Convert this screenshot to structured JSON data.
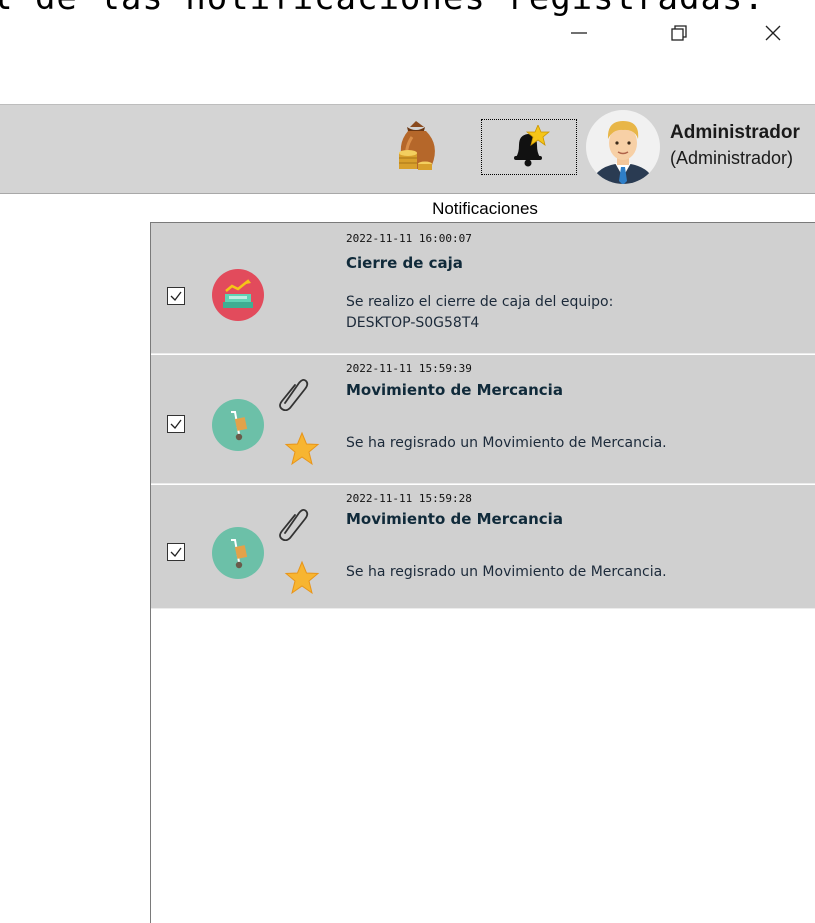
{
  "header_text": "l de las notificaciones registradas.",
  "window_controls": {
    "minimize": "minimize-icon",
    "maximize": "restore-icon",
    "close": "close-icon"
  },
  "toolbar": {
    "money_icon": "money-bag-icon",
    "bell_icon": "bell-star-icon",
    "avatar_icon": "user-avatar-icon",
    "user_name": "Administrador",
    "user_role": "(Administrador)"
  },
  "panel": {
    "title": "Notificaciones",
    "notifications": [
      {
        "checked": true,
        "icon": "cash-register-icon",
        "icon_color": "#e24b5c",
        "timestamp": "2022-11-11 16:00:07",
        "title": "Cierre de caja",
        "body_line1": "Se realizo el cierre de caja del equipo:",
        "body_line2": "DESKTOP-S0G58T4",
        "attachment": false,
        "starred": false
      },
      {
        "checked": true,
        "icon": "hand-truck-icon",
        "icon_color": "#6cc0a8",
        "timestamp": "2022-11-11 15:59:39",
        "title": "Movimiento de Mercancia",
        "body_line1": "Se ha regisrado un Movimiento de Mercancia.",
        "attachment": true,
        "starred": true
      },
      {
        "checked": true,
        "icon": "hand-truck-icon",
        "icon_color": "#6cc0a8",
        "timestamp": "2022-11-11 15:59:28",
        "title": "Movimiento de Mercancia",
        "body_line1": "Se ha regisrado un Movimiento de Mercancia.",
        "attachment": true,
        "starred": true
      }
    ]
  },
  "colors": {
    "toolbar_bg": "#d4d4d4",
    "row_bg": "#d0d0d0",
    "star": "#f7b531"
  }
}
